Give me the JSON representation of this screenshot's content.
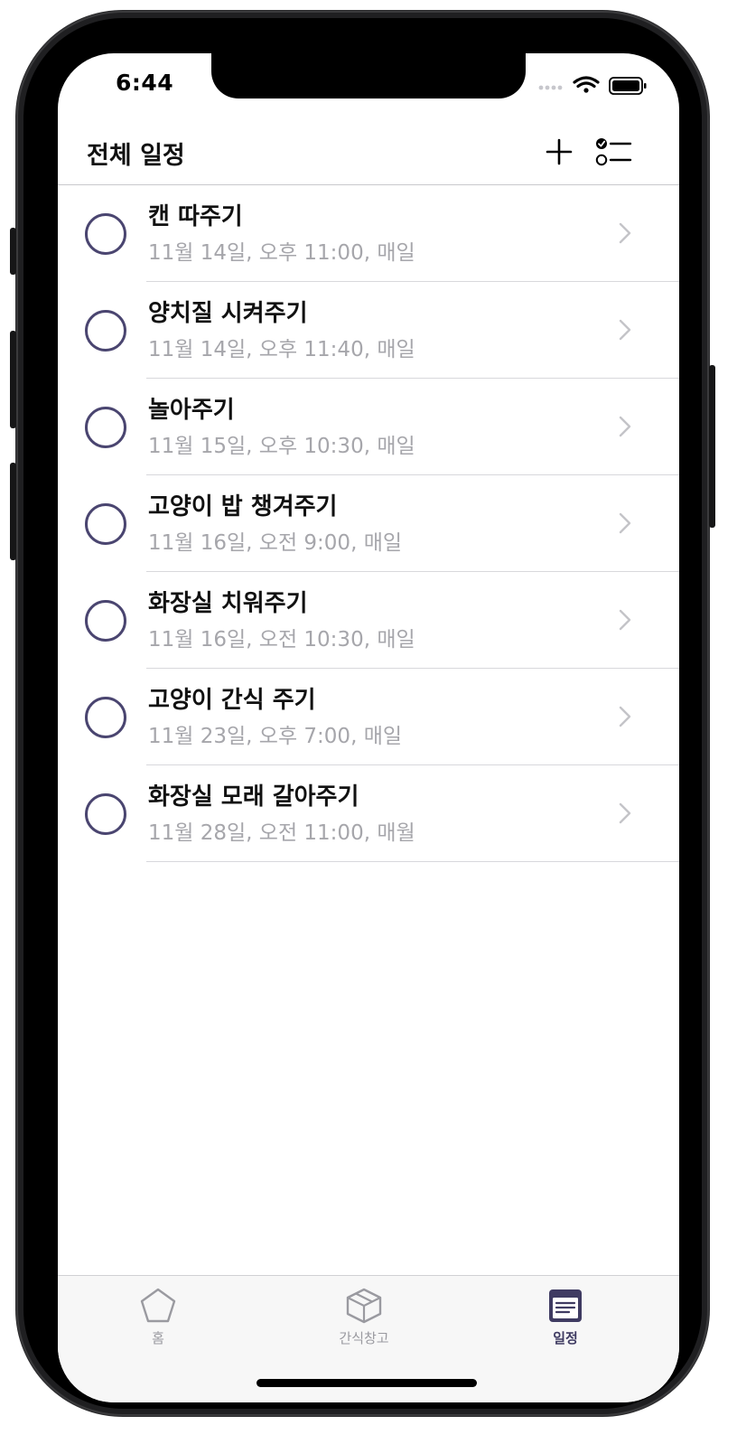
{
  "status_bar": {
    "time": "6:44"
  },
  "header": {
    "title": "전체 일정"
  },
  "schedules": [
    {
      "title": "캔 따주기",
      "subtitle": "11월 14일, 오후 11:00, 매일"
    },
    {
      "title": "양치질 시켜주기",
      "subtitle": "11월 14일, 오후 11:40, 매일"
    },
    {
      "title": "놀아주기",
      "subtitle": "11월 15일, 오후 10:30, 매일"
    },
    {
      "title": "고양이 밥 챙겨주기",
      "subtitle": "11월 16일, 오전 9:00, 매일"
    },
    {
      "title": "화장실 치워주기",
      "subtitle": "11월 16일, 오전 10:30, 매일"
    },
    {
      "title": "고양이 간식 주기",
      "subtitle": "11월 23일, 오후 7:00, 매일"
    },
    {
      "title": "화장실 모래 갈아주기",
      "subtitle": "11월 28일, 오전 11:00, 매월"
    }
  ],
  "tabs": [
    {
      "label": "홈",
      "icon": "pentagon-icon",
      "selected": false
    },
    {
      "label": "간식창고",
      "icon": "box-icon",
      "selected": false
    },
    {
      "label": "일정",
      "icon": "calendar-list-icon",
      "selected": true
    }
  ],
  "colors": {
    "accent": "#4a4570",
    "subtitle": "#a6a6ab",
    "tab_inactive": "#9a9aa0"
  }
}
